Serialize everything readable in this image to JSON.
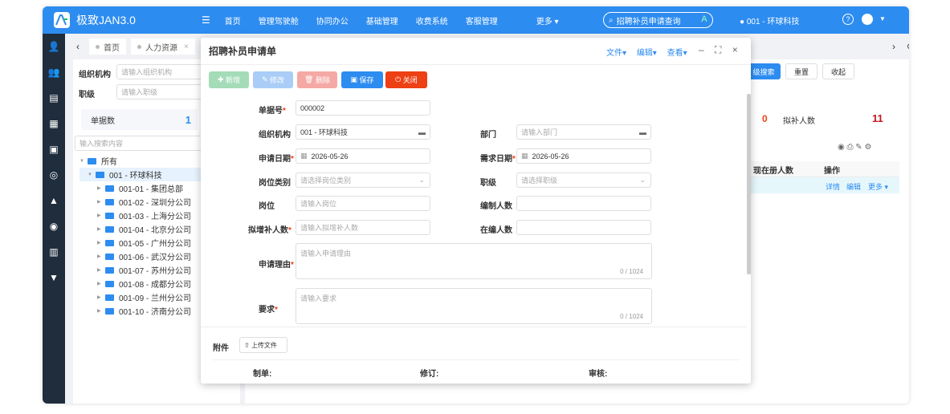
{
  "app": {
    "title": "极致JAN3.0",
    "nav": [
      "首页",
      "管理驾驶舱",
      "协同办公",
      "基础管理",
      "收费系统",
      "客服管理",
      "更多 ▾"
    ],
    "search": "招聘补员申请查询",
    "org": "001 - 环球科技"
  },
  "tabs": [
    "首页",
    "人力资源"
  ],
  "filters": {
    "org_label": "组织机构",
    "org_ph": "请输入组织机构",
    "level_label": "职级",
    "level_ph": "请输入职级"
  },
  "stats": {
    "label": "单据数",
    "value": "1",
    "zero": "0",
    "plan_label": "拟补人数",
    "plan_value": "11"
  },
  "tree": {
    "search_ph": "输入搜索内容",
    "root": "所有",
    "selected": "001 - 环球科技",
    "children": [
      "001-01 - 集团总部",
      "001-02 - 深圳分公司",
      "001-03 - 上海分公司",
      "001-04 - 北京分公司",
      "001-05 - 广州分公司",
      "001-06 - 武汉分公司",
      "001-07 - 苏州分公司",
      "001-08 - 成都分公司",
      "001-09 - 兰州分公司",
      "001-10 - 济南分公司"
    ]
  },
  "right": {
    "adv_search": "级搜索",
    "reset": "重置",
    "collapse": "收起",
    "col_current": "现在册人数",
    "col_ops": "操作",
    "ops": [
      "详情",
      "编辑",
      "更多 ▾"
    ]
  },
  "modal": {
    "title": "招聘补员申请单",
    "menus": [
      "文件▾",
      "编辑▾",
      "查看▾"
    ],
    "buttons": {
      "add": "新增",
      "edit": "修改",
      "del": "删除",
      "save": "保存",
      "close": "关闭"
    },
    "fields": {
      "no_label": "单据号",
      "no_value": "000002",
      "org_label": "组织机构",
      "org_value": "001 - 环球科技",
      "dept_label": "部门",
      "dept_ph": "请输入部门",
      "date_label": "申请日期",
      "date_value": "2026-05-26",
      "need_label": "需求日期",
      "need_value": "2026-05-26",
      "cat_label": "岗位类别",
      "cat_ph": "请选择岗位类别",
      "lvl_label": "职级",
      "lvl_ph": "请选择职级",
      "post_label": "岗位",
      "post_ph": "请输入岗位",
      "quota_label": "编制人数",
      "plan_label": "拟增补人数",
      "plan_ph": "请输入拟增补人数",
      "cur_label": "在编人数",
      "reason_label": "申请理由",
      "reason_ph": "请输入申请理由",
      "req_label": "要求",
      "req_ph": "请输入要求",
      "count": "0 / 1024"
    },
    "attach_label": "附件",
    "upload": "上传文件",
    "maker": "制单:",
    "revise": "修订:",
    "audit": "审核:"
  }
}
